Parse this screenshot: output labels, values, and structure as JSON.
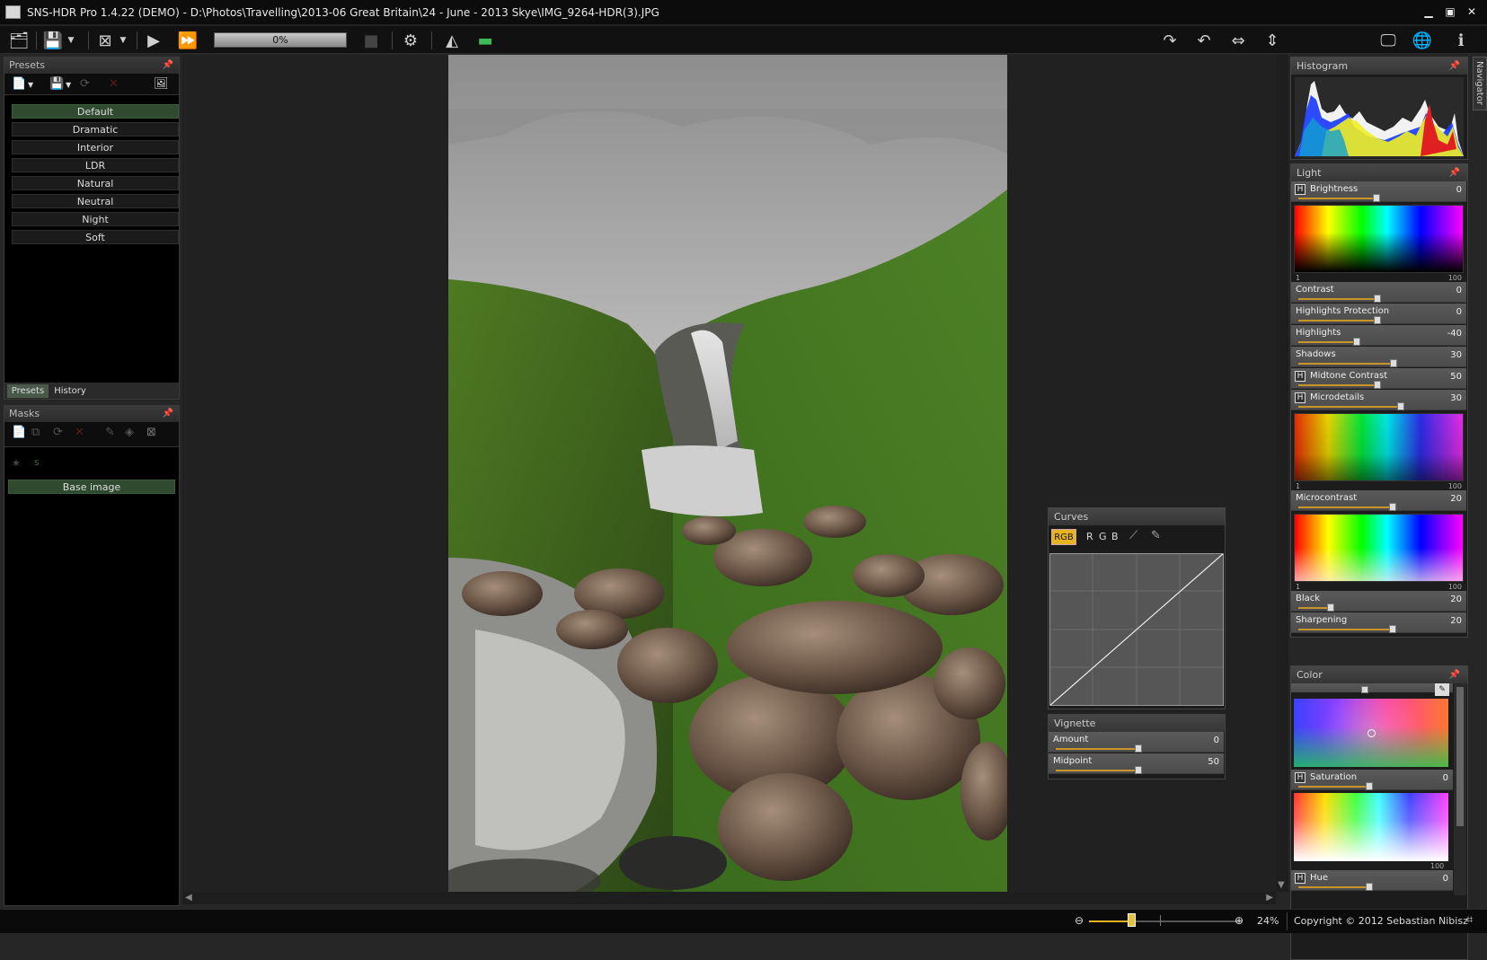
{
  "window": {
    "title": "SNS-HDR Pro 1.4.22 (DEMO) - D:\\Photos\\Travelling\\2013-06 Great Britain\\24 - June - 2013 Skye\\IMG_9264-HDR(3).JPG"
  },
  "toolbar": {
    "progress_label": "0%",
    "progress": 0
  },
  "presets_panel": {
    "title": "Presets",
    "items": [
      "Default",
      "Dramatic",
      "Interior",
      "LDR",
      "Natural",
      "Neutral",
      "Night",
      "Soft"
    ],
    "selected": "Default",
    "tabs": [
      "Presets",
      "History"
    ],
    "active_tab": "Presets"
  },
  "masks_panel": {
    "title": "Masks",
    "items": [
      "Base image"
    ]
  },
  "histogram": {
    "title": "Histogram"
  },
  "navigator": {
    "label": "Navigator"
  },
  "light_panel": {
    "title": "Light",
    "brightness": {
      "label": "Brightness",
      "value": "0"
    },
    "spectrum1_min": "1",
    "spectrum1_max": "100",
    "contrast": {
      "label": "Contrast",
      "value": "0"
    },
    "highlights_protection": {
      "label": "Highlights Protection",
      "value": "0"
    },
    "highlights": {
      "label": "Highlights",
      "value": "-40"
    },
    "shadows": {
      "label": "Shadows",
      "value": "30"
    },
    "midtone_contrast": {
      "label": "Midtone Contrast",
      "value": "50"
    },
    "microdetails": {
      "label": "Microdetails",
      "value": "30"
    },
    "spectrum2_min": "1",
    "spectrum2_max": "100",
    "microcontrast": {
      "label": "Microcontrast",
      "value": "20"
    },
    "spectrum3_min": "1",
    "spectrum3_max": "100",
    "black": {
      "label": "Black",
      "value": "20"
    },
    "sharpening": {
      "label": "Sharpening",
      "value": "20"
    }
  },
  "color_panel": {
    "title": "Color",
    "saturation": {
      "label": "Saturation",
      "value": "0"
    },
    "spectrum_max": "100",
    "hue": {
      "label": "Hue",
      "value": "0"
    }
  },
  "curves": {
    "title": "Curves",
    "channels": [
      "RGB",
      "R",
      "G",
      "B"
    ],
    "active": "RGB"
  },
  "vignette": {
    "title": "Vignette",
    "amount": {
      "label": "Amount",
      "value": "0"
    },
    "midpoint": {
      "label": "Midpoint",
      "value": "50"
    }
  },
  "statusbar": {
    "zoom": "24%",
    "copyright": "Copyright © 2012 Sebastian Nibisz"
  }
}
